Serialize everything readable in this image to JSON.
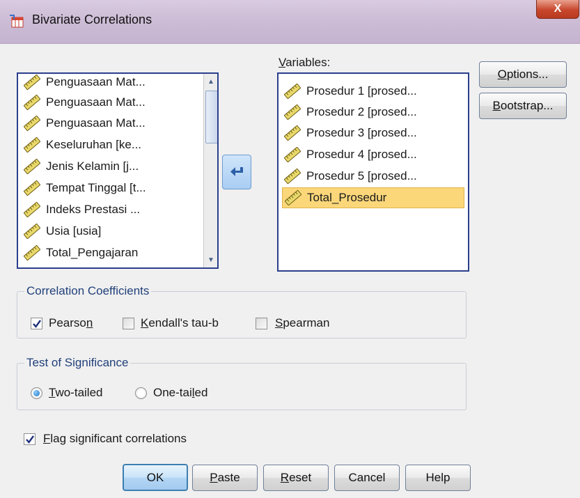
{
  "window": {
    "title": "Bivariate Correlations",
    "close_glyph": "X"
  },
  "source_list": {
    "items": [
      "Penguasaan Mat...",
      "Penguasaan Mat...",
      "Penguasaan Mat...",
      "Keseluruhan [ke...",
      "Jenis Kelamin  [j...",
      "Tempat Tinggal [t...",
      "Indeks Prestasi ...",
      "Usia [usia]",
      "Total_Pengajaran"
    ]
  },
  "variables": {
    "label_prefix": "V",
    "label_rest": "ariables:",
    "items": [
      "Prosedur 1 [prosed...",
      "Prosedur 2 [prosed...",
      "Prosedur 3 [prosed...",
      "Prosedur 4 [prosed...",
      "Prosedur 5 [prosed...",
      "Total_Prosedur"
    ],
    "selected_index": 5
  },
  "side_buttons": {
    "options_u": "O",
    "options_rest": "ptions...",
    "bootstrap_u": "B",
    "bootstrap_rest": "ootstrap..."
  },
  "correlation": {
    "legend": "Correlation Coefficients",
    "pearson_a": "Pearso",
    "pearson_u": "n",
    "kendall_u": "K",
    "kendall_rest": "endall's tau-b",
    "spearman_u": "S",
    "spearman_rest": "pearman",
    "pearson_checked": true,
    "kendall_checked": false,
    "spearman_checked": false
  },
  "significance": {
    "legend": "Test of Significance",
    "two_u": "T",
    "two_rest": "wo-tailed",
    "one_a": "One-tai",
    "one_u": "l",
    "one_rest": "ed",
    "selected": "Two-tailed"
  },
  "flag": {
    "u": "F",
    "rest": "lag significant correlations",
    "checked": true
  },
  "bottom_buttons": {
    "ok": "OK",
    "paste_u": "P",
    "paste_rest": "aste",
    "reset_u": "R",
    "reset_rest": "eset",
    "cancel": "Cancel",
    "help": "Help"
  },
  "colors": {
    "accent": "#2b3f8c",
    "selected_row": "#fbd77a",
    "legend_text": "#21407a"
  }
}
